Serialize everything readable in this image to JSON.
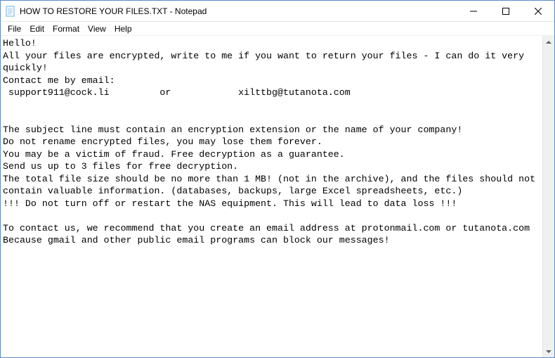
{
  "window": {
    "title": "HOW TO RESTORE YOUR FILES.TXT - Notepad"
  },
  "menu": {
    "file": "File",
    "edit": "Edit",
    "format": "Format",
    "view": "View",
    "help": "Help"
  },
  "document": {
    "body": "Hello!\nAll your files are encrypted, write to me if you want to return your files - I can do it very quickly!\nContact me by email:\n support911@cock.li         or            xilttbg@tutanota.com\n\n\nThe subject line must contain an encryption extension or the name of your company!\nDo not rename encrypted files, you may lose them forever.\nYou may be a victim of fraud. Free decryption as a guarantee.\nSend us up to 3 files for free decryption.\nThe total file size should be no more than 1 MB! (not in the archive), and the files should not contain valuable information. (databases, backups, large Excel spreadsheets, etc.)\n!!! Do not turn off or restart the NAS equipment. This will lead to data loss !!!\n\nTo contact us, we recommend that you create an email address at protonmail.com or tutanota.com\nBecause gmail and other public email programs can block our messages!"
  }
}
